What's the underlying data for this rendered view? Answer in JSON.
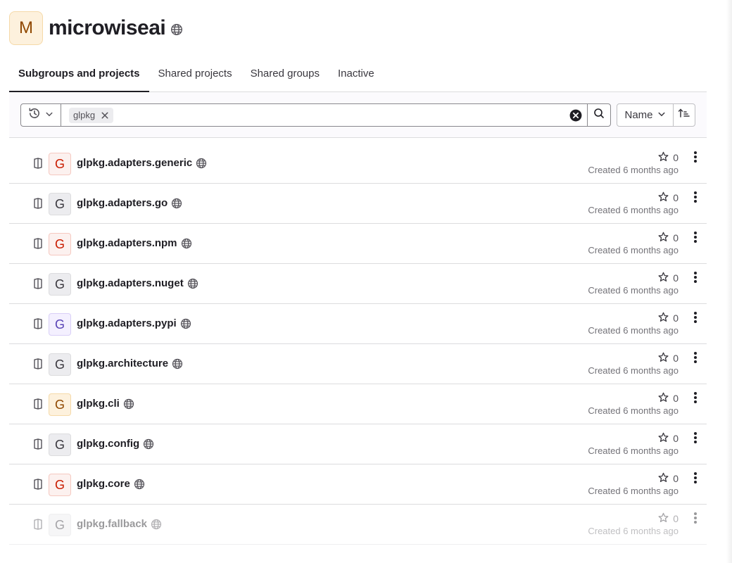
{
  "group": {
    "avatar_letter": "M",
    "name": "microwiseai",
    "visibility_icon": "globe-icon"
  },
  "tabs": [
    {
      "label": "Subgroups and projects",
      "active": true
    },
    {
      "label": "Shared projects",
      "active": false
    },
    {
      "label": "Shared groups",
      "active": false
    },
    {
      "label": "Inactive",
      "active": false
    }
  ],
  "filter": {
    "history_icon": "history-icon",
    "token_value": "glpkg",
    "sort_label": "Name",
    "sort_direction_icon": "sort-ascending-icon"
  },
  "projects": [
    {
      "letter": "G",
      "name": "glpkg.adapters.generic",
      "stars": "0",
      "created": "Created 6 months ago",
      "color": "#c91c00"
    },
    {
      "letter": "G",
      "name": "glpkg.adapters.go",
      "stars": "0",
      "created": "Created 6 months ago",
      "color": "#3a383f"
    },
    {
      "letter": "G",
      "name": "glpkg.adapters.npm",
      "stars": "0",
      "created": "Created 6 months ago",
      "color": "#c91c00"
    },
    {
      "letter": "G",
      "name": "glpkg.adapters.nuget",
      "stars": "0",
      "created": "Created 6 months ago",
      "color": "#3a383f"
    },
    {
      "letter": "G",
      "name": "glpkg.adapters.pypi",
      "stars": "0",
      "created": "Created 6 months ago",
      "color": "#5943b6"
    },
    {
      "letter": "G",
      "name": "glpkg.architecture",
      "stars": "0",
      "created": "Created 6 months ago",
      "color": "#3a383f"
    },
    {
      "letter": "G",
      "name": "glpkg.cli",
      "stars": "0",
      "created": "Created 6 months ago",
      "color": "#8f4700"
    },
    {
      "letter": "G",
      "name": "glpkg.config",
      "stars": "0",
      "created": "Created 6 months ago",
      "color": "#3a383f"
    },
    {
      "letter": "G",
      "name": "glpkg.core",
      "stars": "0",
      "created": "Created 6 months ago",
      "color": "#c91c00"
    },
    {
      "letter": "G",
      "name": "glpkg.fallback",
      "stars": "0",
      "created": "Created 6 months ago",
      "color": "#3a383f"
    }
  ]
}
